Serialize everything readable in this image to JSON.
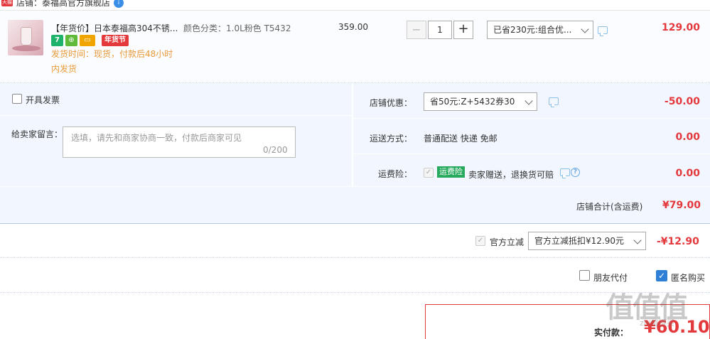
{
  "shop": {
    "platform_badge": "天猫",
    "label": "店铺：泰福高官方旗舰店"
  },
  "item": {
    "title": "【年货价】日本泰福高304不锈...",
    "sku": "颜色分类：1.0L粉色 T5432",
    "badges": [
      "7",
      "⊕",
      "▭",
      "年货节"
    ],
    "delivery_line1": "发货时间：现货，付款后48小时",
    "delivery_line2": "内发货",
    "unit_price": "359.00",
    "quantity": "1",
    "qty_minus": "−",
    "qty_plus": "+",
    "promo_select": "已省230元:组合优...",
    "total": "129.00"
  },
  "invoice": {
    "label": "开具发票"
  },
  "note": {
    "label": "给卖家留言：",
    "placeholder": "选填，请先和商家协商一致，付款后商家可见",
    "count": "0/200"
  },
  "coupon": {
    "label": "店铺优惠：",
    "select": "省50元:Z+5432券30",
    "value": "-50.00"
  },
  "shipping": {
    "label": "运送方式：",
    "text": "普通配送 快递 免邮",
    "value": "0.00"
  },
  "insurance": {
    "label": "运费险：",
    "badge": "运费险",
    "text": "卖家赠送，退换货可赔",
    "help": "?",
    "value": "0.00"
  },
  "subtotal": {
    "label": "店铺合计(含运费)",
    "value": "¥79.00"
  },
  "official_discount": {
    "label": "官方立减",
    "select": "官方立减抵扣¥12.90元",
    "value": "-¥12.90"
  },
  "options": {
    "friend_pay": "朋友代付",
    "anonymous": "匿名购买",
    "anonymous_check": "✓"
  },
  "payment": {
    "label": "实付款：",
    "value": "¥60.10"
  },
  "watermark": {
    "main": "值值值",
    "sub": "zhi值得买"
  },
  "colors": {
    "accent_red": "#e4393c",
    "panel_blue": "#f2f7ff",
    "delivery_orange": "#e89b3a",
    "checkbox_blue": "#2f7fd6",
    "insurance_green": "#25a95c"
  },
  "icons": [
    "tmall-icon",
    "info-icon",
    "chat-icon",
    "chevron-down-icon",
    "help-icon",
    "check-icon"
  ]
}
